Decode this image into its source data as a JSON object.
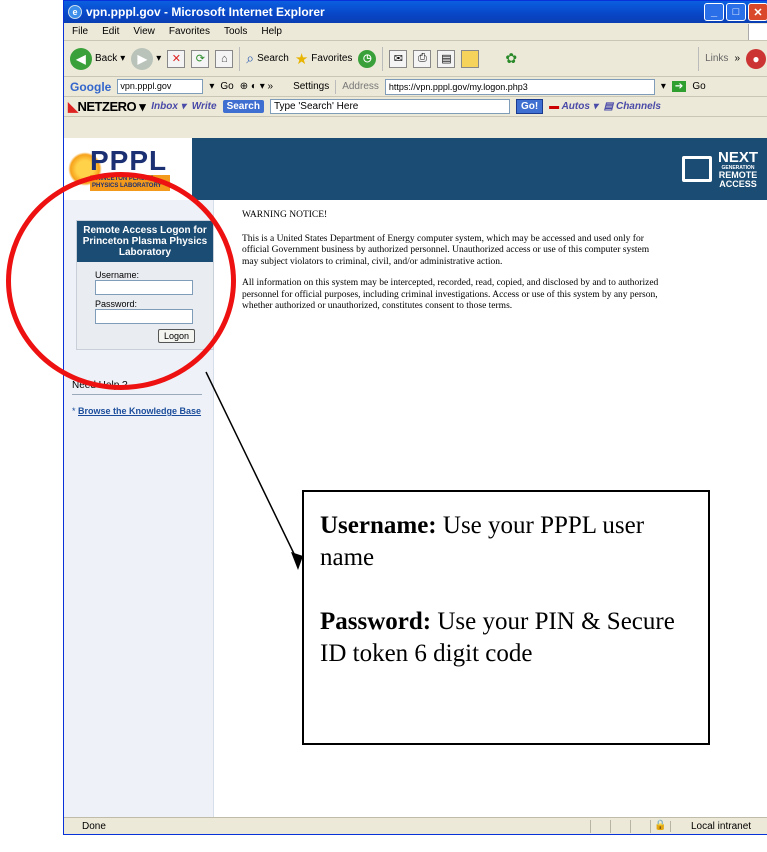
{
  "window": {
    "title": "vpn.pppl.gov - Microsoft Internet Explorer"
  },
  "menu": {
    "items": [
      "File",
      "Edit",
      "View",
      "Favorites",
      "Tools",
      "Help"
    ]
  },
  "toolbar": {
    "back_label": "Back",
    "search_label": "Search",
    "favorites_label": "Favorites",
    "address_label": "Address",
    "address_value": "https://vpn.pppl.gov/my.logon.php3",
    "links_label": "Links",
    "go_label": "Go"
  },
  "google_bar": {
    "brand": "Google",
    "search_value": "vpn.pppl.gov",
    "go_label": "Go",
    "settings_label": "Settings"
  },
  "netzero_bar": {
    "brand": "NETZERO",
    "inbox_label": "Inbox",
    "write_label": "Write",
    "search_button": "Search",
    "search_placeholder": "Type 'Search' Here",
    "go_label": "Go!",
    "autos_label": "Autos",
    "channels_label": "Channels"
  },
  "page": {
    "logo_text": "PPPL",
    "logo_subtitle": "Princeton Plasma Physics Laboratory",
    "next_logo": {
      "line1": "NEXT",
      "line2": "GENERATION",
      "line3": "REMOTE",
      "line4": "ACCESS"
    },
    "logon_header": "Remote Access Logon for Princeton Plasma Physics Laboratory",
    "username_label": "Username:",
    "password_label": "Password:",
    "logon_button": "Logon",
    "need_help": "Need Help ?",
    "kb_link": "Browse the Knowledge Base",
    "warning_title": "WARNING NOTICE!",
    "warning_p1": "This is a United States Department of Energy computer system, which may be accessed and used only for official Government business by authorized personnel. Unauthorized access or use of this computer system may subject violators to criminal, civil, and/or administrative action.",
    "warning_p2": "All information on this system may be intercepted, recorded, read, copied, and disclosed by and to authorized personnel for official purposes, including criminal investigations. Access or use of this system by any person, whether authorized or unauthorized, constitutes consent to those terms."
  },
  "status": {
    "text": "Done",
    "zone": "Local intranet"
  },
  "callout": {
    "username_bold": "Username:",
    "username_text": " Use your PPPL user name",
    "password_bold": "Password:",
    "password_text": "  Use your PIN & Secure ID token 6 digit code"
  },
  "colors": {
    "banner": "#1b4c73",
    "annotation_red": "#ee1111"
  }
}
